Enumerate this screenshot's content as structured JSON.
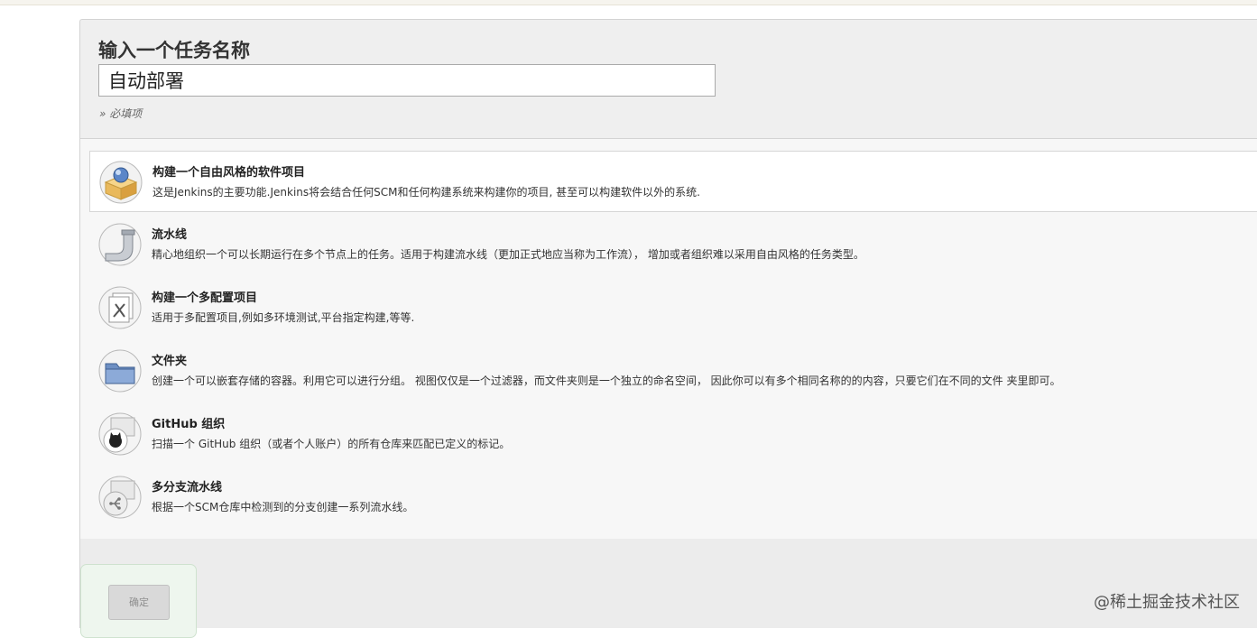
{
  "form": {
    "name_label": "输入一个任务名称",
    "name_value": "自动部署",
    "required_hint": "» 必填项"
  },
  "job_types": [
    {
      "title": "构建一个自由风格的软件项目",
      "description": "这是Jenkins的主要功能.Jenkins将会结合任何SCM和任何构建系统来构建你的项目, 甚至可以构建软件以外的系统.",
      "icon": "freestyle-box-icon",
      "selected": true
    },
    {
      "title": "流水线",
      "description": "精心地组织一个可以长期运行在多个节点上的任务。适用于构建流水线（更加正式地应当称为工作流）， 增加或者组织难以采用自由风格的任务类型。",
      "icon": "pipeline-icon",
      "selected": false
    },
    {
      "title": "构建一个多配置项目",
      "description": "适用于多配置项目,例如多环境测试,平台指定构建,等等.",
      "icon": "multi-config-icon",
      "selected": false
    },
    {
      "title": "文件夹",
      "description": "创建一个可以嵌套存储的容器。利用它可以进行分组。 视图仅仅是一个过滤器，而文件夹则是一个独立的命名空间， 因此你可以有多个相同名称的的内容，只要它们在不同的文件 夹里即可。",
      "icon": "folder-icon",
      "selected": false
    },
    {
      "title": "GitHub 组织",
      "description": "扫描一个 GitHub 组织（或者个人账户）的所有仓库来匹配已定义的标记。",
      "icon": "github-org-icon",
      "selected": false
    },
    {
      "title": "多分支流水线",
      "description": "根据一个SCM仓库中检测到的分支创建一系列流水线。",
      "icon": "multibranch-icon",
      "selected": false
    }
  ],
  "actions": {
    "ok_label": "确定"
  },
  "watermark": "@稀土掘金技术社区"
}
